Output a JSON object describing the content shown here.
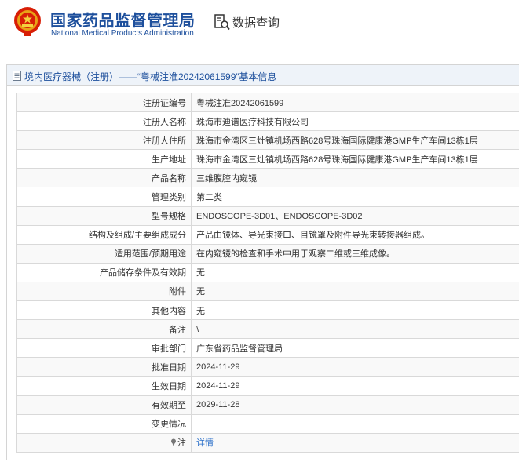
{
  "header": {
    "logo_cn": "国家药品监督管理局",
    "logo_en": "National Medical Products Administration",
    "query_label": "数据查询"
  },
  "panel": {
    "title": "境内医疗器械（注册）——“粤械注准20242061599”基本信息"
  },
  "rows": [
    {
      "label": "注册证编号",
      "value": "粤械注准20242061599"
    },
    {
      "label": "注册人名称",
      "value": "珠海市迪谱医疗科技有限公司"
    },
    {
      "label": "注册人住所",
      "value": "珠海市金湾区三灶镇机场西路628号珠海国际健康港GMP生产车间13栋1层"
    },
    {
      "label": "生产地址",
      "value": "珠海市金湾区三灶镇机场西路628号珠海国际健康港GMP生产车间13栋1层"
    },
    {
      "label": "产品名称",
      "value": "三维腹腔内窥镜"
    },
    {
      "label": "管理类别",
      "value": "第二类"
    },
    {
      "label": "型号规格",
      "value": "ENDOSCOPE-3D01、ENDOSCOPE-3D02"
    },
    {
      "label": "结构及组成/主要组成成分",
      "value": "产品由镜体、导光束接口、目镜罩及附件导光束转接器组成。"
    },
    {
      "label": "适用范围/预期用途",
      "value": "在内窥镜的检查和手术中用于观察二维或三维成像。"
    },
    {
      "label": "产品储存条件及有效期",
      "value": "无"
    },
    {
      "label": "附件",
      "value": "无"
    },
    {
      "label": "其他内容",
      "value": "无"
    },
    {
      "label": "备注",
      "value": "\\"
    },
    {
      "label": "审批部门",
      "value": "广东省药品监督管理局"
    },
    {
      "label": "批准日期",
      "value": "2024-11-29"
    },
    {
      "label": "生效日期",
      "value": "2024-11-29"
    },
    {
      "label": "有效期至",
      "value": "2029-11-28"
    },
    {
      "label": "变更情况",
      "value": ""
    },
    {
      "label": "注",
      "value": "详情"
    }
  ]
}
